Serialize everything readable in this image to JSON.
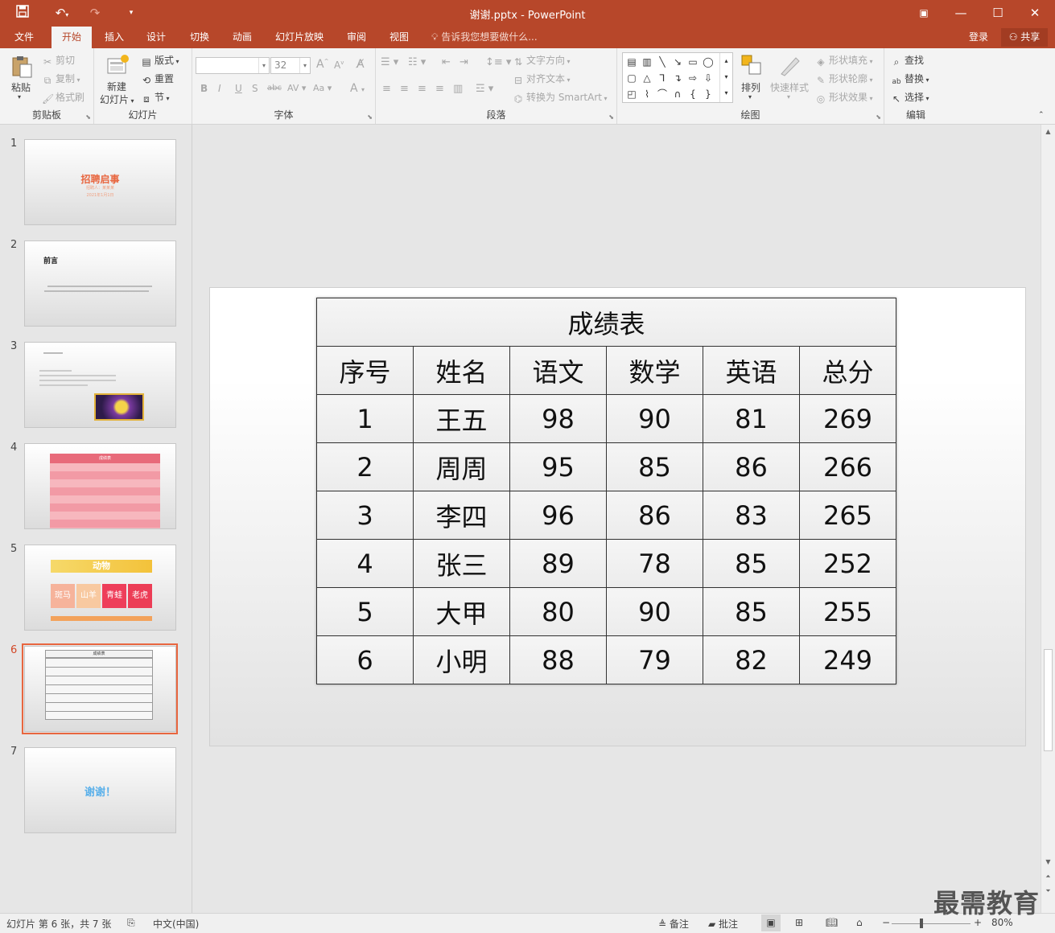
{
  "window": {
    "title": "谢谢.pptx - PowerPoint"
  },
  "tabs": [
    "文件",
    "开始",
    "插入",
    "设计",
    "切换",
    "动画",
    "幻灯片放映",
    "审阅",
    "视图"
  ],
  "tell_me": "告诉我您想要做什么...",
  "login": "登录",
  "share": "共享",
  "ribbon": {
    "clipboard": {
      "label": "剪贴板",
      "paste": "粘贴",
      "cut": "剪切",
      "copy": "复制",
      "format_painter": "格式刷"
    },
    "slides": {
      "label": "幻灯片",
      "new_slide_1": "新建",
      "new_slide_2": "幻灯片",
      "layout": "版式",
      "reset": "重置",
      "section": "节"
    },
    "font": {
      "label": "字体",
      "font_name": "",
      "font_size": "32"
    },
    "paragraph": {
      "label": "段落",
      "text_direction": "文字方向",
      "align_text": "对齐文本",
      "convert_smartart": "转换为 SmartArt"
    },
    "drawing": {
      "label": "绘图",
      "arrange": "排列",
      "quick_styles": "快速样式",
      "shape_fill": "形状填充",
      "shape_outline": "形状轮廓",
      "shape_effects": "形状效果"
    },
    "editing": {
      "label": "编辑",
      "find": "查找",
      "replace": "替换",
      "select": "选择"
    }
  },
  "thumbnails": [
    {
      "num": "1",
      "title": "招聘启事",
      "sub1": "招聘人：某某某",
      "sub2": "2021年1月1日"
    },
    {
      "num": "2",
      "title": "前言"
    },
    {
      "num": "3"
    },
    {
      "num": "4",
      "title": "成绩表"
    },
    {
      "num": "5",
      "title": "动物",
      "cards": [
        "斑马",
        "山羊",
        "青蛙",
        "老虎"
      ]
    },
    {
      "num": "6",
      "title": "成绩表"
    },
    {
      "num": "7",
      "title": "谢谢！"
    }
  ],
  "table": {
    "caption": "成绩表",
    "headers": [
      "序号",
      "姓名",
      "语文",
      "数学",
      "英语",
      "总分"
    ],
    "rows": [
      [
        "1",
        "王五",
        "98",
        "90",
        "81",
        "269"
      ],
      [
        "2",
        "周周",
        "95",
        "85",
        "86",
        "266"
      ],
      [
        "3",
        "李四",
        "96",
        "86",
        "83",
        "265"
      ],
      [
        "4",
        "张三",
        "89",
        "78",
        "85",
        "252"
      ],
      [
        "5",
        "大甲",
        "80",
        "90",
        "85",
        "255"
      ],
      [
        "6",
        "小明",
        "88",
        "79",
        "82",
        "249"
      ]
    ]
  },
  "status": {
    "slide_info": "幻灯片 第 6 张，共 7 张",
    "language": "中文(中国)",
    "notes": "备注",
    "comments": "批注",
    "zoom": "80%"
  },
  "watermark": "最需教育",
  "colors": {
    "accent": "#b7472a",
    "selected_thumb": "#e8663f"
  }
}
